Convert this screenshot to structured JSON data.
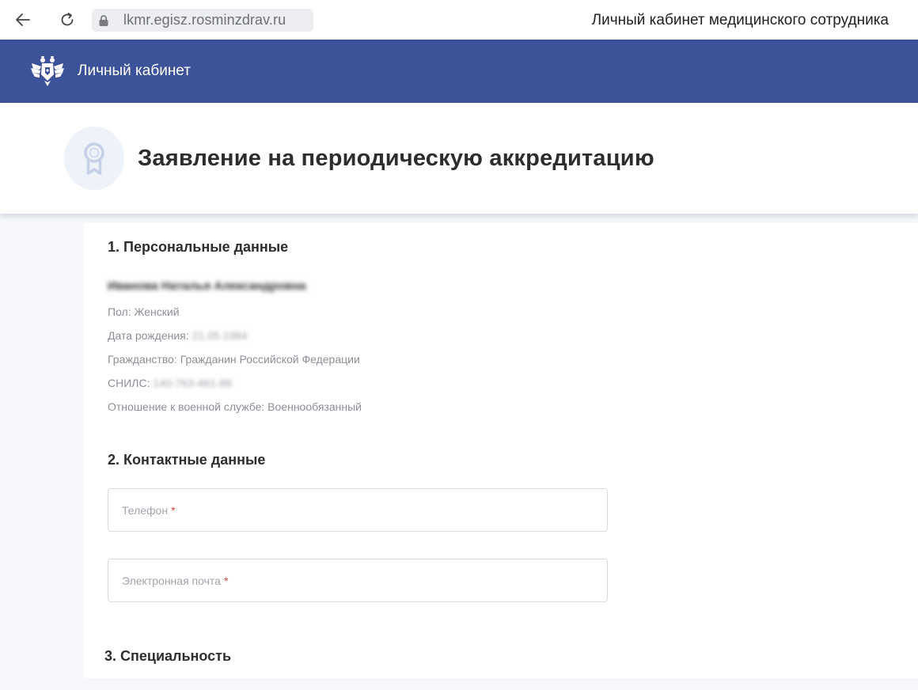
{
  "browser": {
    "url": "lkmr.egisz.rosminzdrav.ru",
    "tab_title": "Личный кабинет медицинского сотрудника"
  },
  "header": {
    "title": "Личный кабинет",
    "brand_color": "#3d5399"
  },
  "page": {
    "title": "Заявление на периодическую аккредитацию"
  },
  "sections": {
    "personal": {
      "heading": "1. Персональные данные",
      "name": "Иванова Наталья Александровна",
      "gender_label": "Пол:",
      "gender_value": "Женский",
      "birthdate_label": "Дата рождения:",
      "birthdate_value": "21.05.1984",
      "citizenship_label": "Гражданство:",
      "citizenship_value": "Гражданин Российской Федерации",
      "snils_label": "СНИЛС:",
      "snils_value": "140-763-461-86",
      "military_label": "Отношение к военной службе:",
      "military_value": "Военнообязанный"
    },
    "contacts": {
      "heading": "2. Контактные данные",
      "phone_label": "Телефон",
      "email_label": "Электронная почта",
      "required_mark": "*"
    },
    "specialty": {
      "heading": "3. Специальность"
    }
  },
  "icons": {
    "back": "arrow-left-icon",
    "reload": "reload-icon",
    "lock": "lock-icon",
    "emblem": "eagle-emblem-icon",
    "badge": "award-ribbon-icon"
  }
}
